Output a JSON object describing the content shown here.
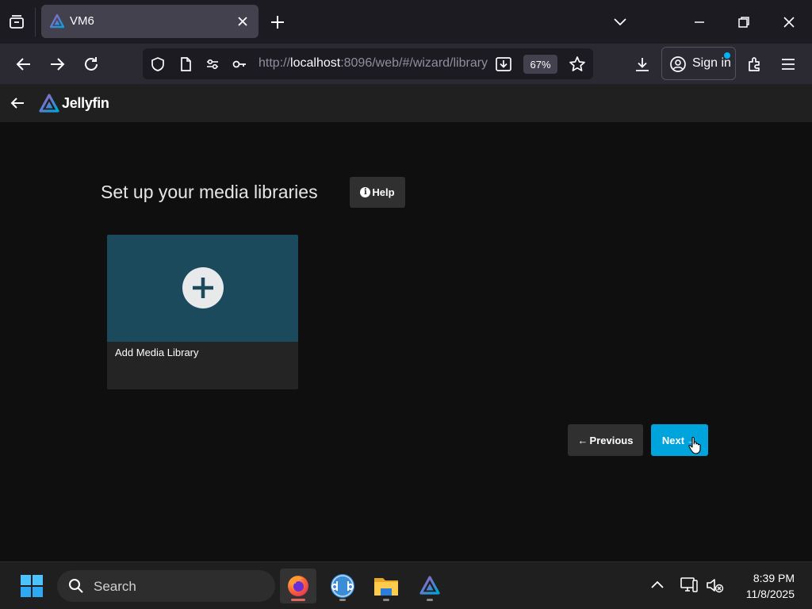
{
  "browser": {
    "tab_title": "VM6",
    "url_prefix": "http://",
    "url_host": "localhost",
    "url_rest": ":8096/web/#/wizard/library",
    "zoom": "67%",
    "signin_label": "Sign in"
  },
  "app": {
    "name": "Jellyfin"
  },
  "page": {
    "title": "Set up your media libraries",
    "help_label": "Help",
    "help_glyph": "i",
    "card_label": "Add Media Library",
    "prev_label": "Previous",
    "prev_arrow": "←",
    "next_label": "Next",
    "next_arrow": "→"
  },
  "taskbar": {
    "search_label": "Search",
    "time": "8:39 PM",
    "date": "11/8/2025"
  },
  "colors": {
    "accent": "#00a4dc",
    "card_image": "#1b4a5c"
  }
}
